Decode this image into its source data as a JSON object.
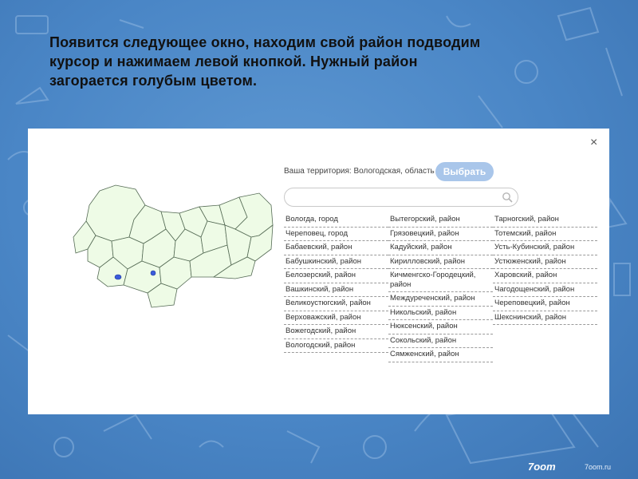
{
  "slide": {
    "title": "Появится следующее окно, находим свой район подводим\nкурсор  и нажимаем левой кнопкой. Нужный район\nзагорается голубым цветом."
  },
  "dialog": {
    "close_label": "×",
    "territory_label": "Ваша территория: Вологодская, область",
    "select_button": "Выбрать",
    "search": {
      "placeholder": "",
      "value": ""
    },
    "columns": [
      [
        "Вологда, город",
        "Череповец, город",
        "Бабаевский, район",
        "Бабушкинский, район",
        "Белозерский, район",
        "Вашкинский, район",
        "Великоустюгский, район",
        "Верховажский, район",
        "Вожегодский, район",
        "Вологодский, район"
      ],
      [
        "Вытегорский, район",
        "Грязовецкий, район",
        "Кадуйский, район",
        "Кирилловский, район",
        "Кичменгско-Городецкий, район",
        "Междуреченский, район",
        "Никольский, район",
        "Нюксенский, район",
        "Сокольский, район",
        "Сямженский, район"
      ],
      [
        "Тарногский, район",
        "Тотемский, район",
        "Усть-Кубинский, район",
        "Устюженский, район",
        "Харовский, район",
        "Чагодощенский, район",
        "Череповецкий, район",
        "Шекснинский, район"
      ]
    ]
  },
  "branding": {
    "logo": "7oom",
    "url": "7oom.ru"
  },
  "colors": {
    "background": "#4a86c6",
    "map_fill": "#eefbe6",
    "map_highlight": "#3b5bdb",
    "button": "#a9c6ea"
  },
  "icons": {
    "search": "search-icon",
    "close": "close-icon"
  }
}
